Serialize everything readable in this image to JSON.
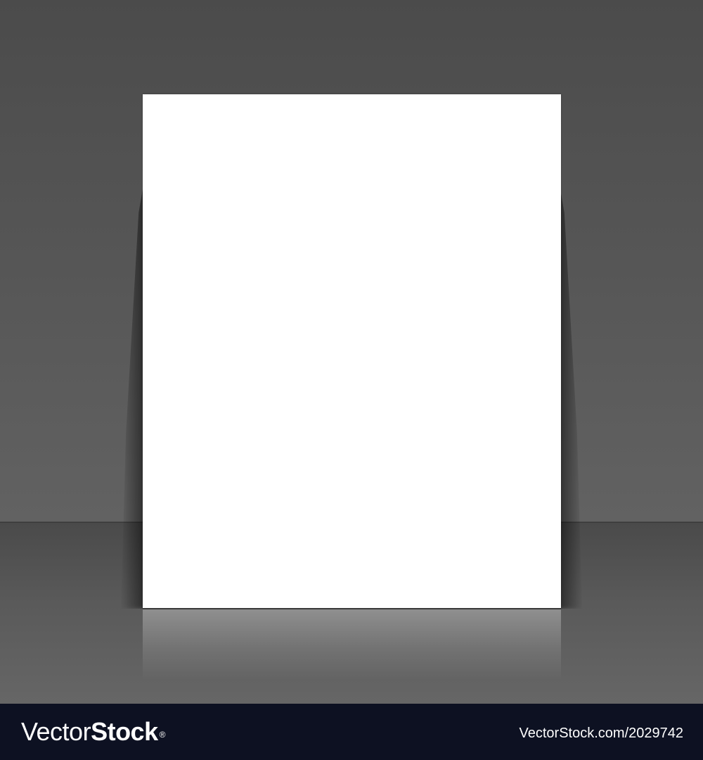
{
  "watermark": {
    "logo_part_1": "Vector",
    "logo_part_2": "Stock",
    "registered_mark": "®",
    "image_id_text": "VectorStock.com/2029742"
  },
  "colors": {
    "wall": "#555555",
    "floor": "#5a5a5a",
    "paper": "#ffffff",
    "footer": "#0d1122"
  }
}
